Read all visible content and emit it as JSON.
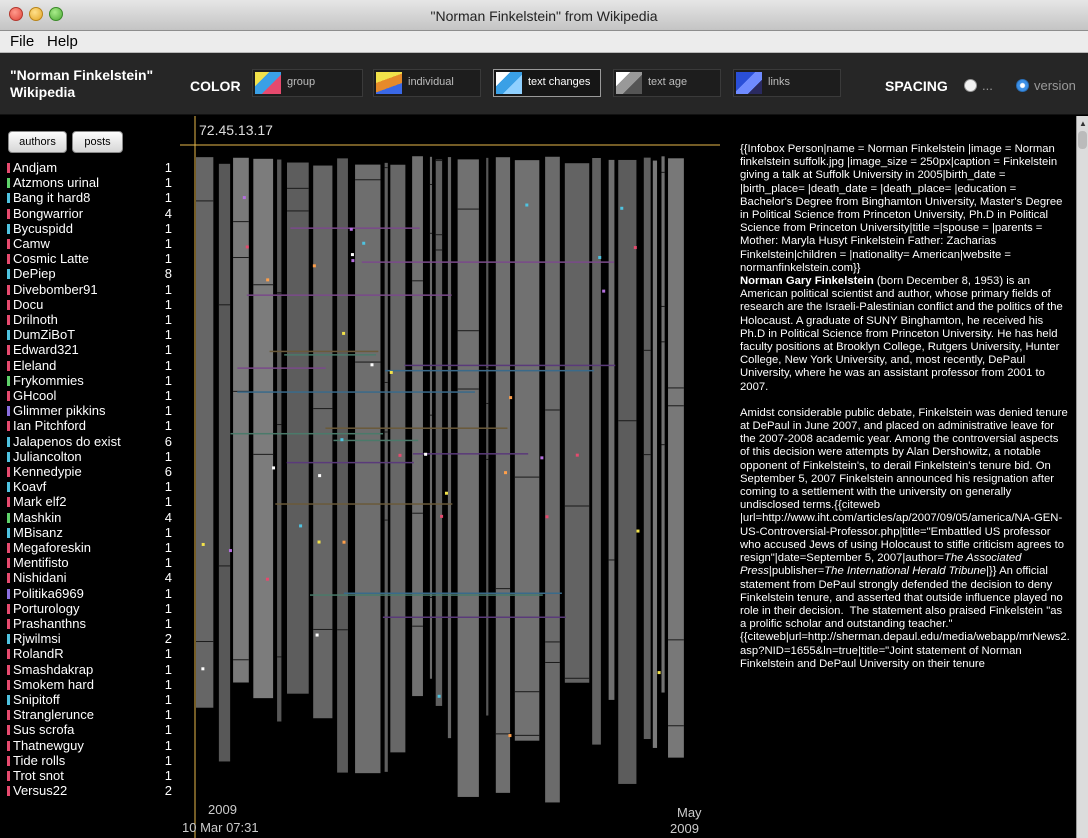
{
  "window": {
    "title": "\"Norman Finkelstein\" from Wikipedia"
  },
  "menu": [
    "File",
    "Help"
  ],
  "toolbar": {
    "app_title_line1": "\"Norman Finkelstein\"",
    "app_title_line2": "Wikipedia",
    "color_label": "COLOR",
    "color_modes": [
      {
        "label": "group",
        "active": false
      },
      {
        "label": "individual",
        "active": false
      },
      {
        "label": "text changes",
        "active": true
      },
      {
        "label": "text age",
        "active": false
      },
      {
        "label": "links",
        "active": false
      }
    ],
    "spacing_label": "SPACING",
    "spacing_options": [
      {
        "label": "...",
        "selected": false
      },
      {
        "label": "version",
        "selected": true
      }
    ]
  },
  "sidebar": {
    "tabs": [
      "authors",
      "posts"
    ],
    "authors": [
      {
        "name": "Andjam",
        "count": "1",
        "color": "#e64a6e"
      },
      {
        "name": "Atzmons urinal",
        "count": "1",
        "color": "#5fd26a"
      },
      {
        "name": "Bang it hard8",
        "count": "1",
        "color": "#4fc3e0"
      },
      {
        "name": "Bongwarrior",
        "count": "4",
        "color": "#e64a6e"
      },
      {
        "name": "Bycuspidd",
        "count": "1",
        "color": "#4fc3e0"
      },
      {
        "name": "Camw",
        "count": "1",
        "color": "#e64a6e"
      },
      {
        "name": "Cosmic Latte",
        "count": "1",
        "color": "#e64a6e"
      },
      {
        "name": "DePiep",
        "count": "8",
        "color": "#4fc3e0"
      },
      {
        "name": "Divebomber91",
        "count": "1",
        "color": "#e64a6e"
      },
      {
        "name": "Docu",
        "count": "1",
        "color": "#e64a6e"
      },
      {
        "name": "Drilnoth",
        "count": "1",
        "color": "#e64a6e"
      },
      {
        "name": "DumZiBoT",
        "count": "1",
        "color": "#4fc3e0"
      },
      {
        "name": "Edward321",
        "count": "1",
        "color": "#e64a6e"
      },
      {
        "name": "Eleland",
        "count": "1",
        "color": "#e64a6e"
      },
      {
        "name": "Frykommies",
        "count": "1",
        "color": "#5fd26a"
      },
      {
        "name": "GHcool",
        "count": "1",
        "color": "#e64a6e"
      },
      {
        "name": "Glimmer pikkins",
        "count": "1",
        "color": "#8b6fe0"
      },
      {
        "name": "Ian Pitchford",
        "count": "1",
        "color": "#e64a6e"
      },
      {
        "name": "Jalapenos do exist",
        "count": "6",
        "color": "#4fc3e0"
      },
      {
        "name": "Juliancolton",
        "count": "1",
        "color": "#4fc3e0"
      },
      {
        "name": "Kennedypie",
        "count": "6",
        "color": "#e64a6e"
      },
      {
        "name": "Koavf",
        "count": "1",
        "color": "#4fc3e0"
      },
      {
        "name": "Mark elf2",
        "count": "1",
        "color": "#e64a6e"
      },
      {
        "name": "Mashkin",
        "count": "4",
        "color": "#5fd26a"
      },
      {
        "name": "MBisanz",
        "count": "1",
        "color": "#4fc3e0"
      },
      {
        "name": "Megaforeskin",
        "count": "1",
        "color": "#e64a6e"
      },
      {
        "name": "Mentifisto",
        "count": "1",
        "color": "#e64a6e"
      },
      {
        "name": "Nishidani",
        "count": "4",
        "color": "#e64a6e"
      },
      {
        "name": "Politika6969",
        "count": "1",
        "color": "#8b6fe0"
      },
      {
        "name": "Porturology",
        "count": "1",
        "color": "#e64a6e"
      },
      {
        "name": "Prashanthns",
        "count": "1",
        "color": "#e64a6e"
      },
      {
        "name": "Rjwilmsi",
        "count": "2",
        "color": "#4fc3e0"
      },
      {
        "name": "RolandR",
        "count": "1",
        "color": "#e64a6e"
      },
      {
        "name": "Smashdakrap",
        "count": "1",
        "color": "#e64a6e"
      },
      {
        "name": "Smokem hard",
        "count": "1",
        "color": "#e64a6e"
      },
      {
        "name": "Snipitoff",
        "count": "1",
        "color": "#4fc3e0"
      },
      {
        "name": "Stranglerunce",
        "count": "1",
        "color": "#e64a6e"
      },
      {
        "name": "Sus scrofa",
        "count": "1",
        "color": "#e64a6e"
      },
      {
        "name": "Thatnewguy",
        "count": "1",
        "color": "#e64a6e"
      },
      {
        "name": "Tide rolls",
        "count": "1",
        "color": "#e64a6e"
      },
      {
        "name": "Trot snot",
        "count": "1",
        "color": "#e64a6e"
      },
      {
        "name": "Versus22",
        "count": "2",
        "color": "#e64a6e"
      }
    ]
  },
  "viz": {
    "hover_ip": "72.45.13.17",
    "start_year": "2009",
    "selected_date": "10 Mar 07:31",
    "end_month": "May",
    "end_year": "2009"
  },
  "text_panel": {
    "infobox": "{{Infobox Person|name = Norman Finkelstein |image = Norman finkelstein suffolk.jpg |image_size = 250px|caption = Finkelstein giving a talk at Suffolk University in 2005|birth_date = |birth_place= |death_date = |death_place= |education = Bachelor's Degree from Binghamton University, Master's Degree in Political Science from Princeton University, Ph.D in Political Science from Princeton University|title =|spouse = |parents = Mother: Maryla Husyt Finkelstein Father: Zacharias Finkelstein|children = |nationality= American|website = normanfinkelstein.com}}",
    "bold_name": "Norman Gary Finkelstein",
    "intro": " (born December 8, 1953) is an American political scientist and author, whose primary fields of research are the Israeli-Palestinian conflict and the politics of the Holocaust. A graduate of SUNY Binghamton, he received his Ph.D in Political Science from Princeton University. He has held faculty positions at Brooklyn College, Rutgers University, Hunter College, New York University, and, most recently, DePaul University, where he was an assistant professor from 2001 to 2007.",
    "para2_a": "Amidst considerable public debate, Finkelstein was denied tenure at DePaul in June 2007, and placed on administrative leave for the 2007-2008 academic year. Among the controversial aspects of this decision were attempts by Alan Dershowitz, a notable opponent of Finkelstein's, to derail Finkelstein's tenure bid. On September 5, 2007 Finkelstein announced his resignation after coming to a settlement with the university on generally undisclosed terms.{{citeweb |url=http://www.iht.com/articles/ap/2007/09/05/america/NA-GEN-US-Controversial-Professor.php|title=\"Embattled US professor who accused Jews of using Holocaust to stifle criticism agrees to resign\"|date=September 5, 2007|author=",
    "para2_author": "The Associated Press",
    "para2_b": "|publisher=",
    "para2_pub": "The International Herald Tribune",
    "para2_c": "|}} An official statement from DePaul strongly defended the decision to deny Finkelstein tenure, and asserted that outside influence played no role in their decision.  The statement also praised Finkelstein \"as a prolific scholar and outstanding teacher.\" {{citeweb|url=http://sherman.depaul.edu/media/webapp/mrNews2.asp?NID=1655&ln=true|title=\"Joint statement of Norman Finkelstein and DePaul University on their tenure"
  }
}
